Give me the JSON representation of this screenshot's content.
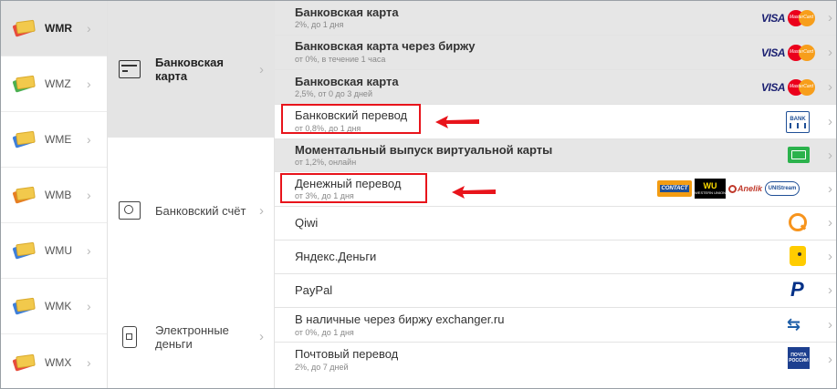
{
  "wallets": [
    {
      "label": "WMR",
      "color": "#e74c3c",
      "active": true
    },
    {
      "label": "WMZ",
      "color": "#4caf50",
      "active": false
    },
    {
      "label": "WME",
      "color": "#3f7fd8",
      "active": false
    },
    {
      "label": "WMB",
      "color": "#e67e22",
      "active": false
    },
    {
      "label": "WMU",
      "color": "#3f7fd8",
      "active": false
    },
    {
      "label": "WMK",
      "color": "#3f7fd8",
      "active": false
    },
    {
      "label": "WMX",
      "color": "#e74c3c",
      "active": false
    }
  ],
  "types": [
    {
      "label": "Банковская карта",
      "icon": "bank-card-icon",
      "active": true
    },
    {
      "label": "Банковский счёт",
      "icon": "safe-icon",
      "active": false
    },
    {
      "label": "Электронные деньги",
      "icon": "phone-wallet-icon",
      "active": false
    }
  ],
  "options": [
    {
      "title": "Банковская карта",
      "sub": "2%, до 1 дня",
      "logo": "visa-mastercard-logo"
    },
    {
      "title": "Банковская карта через биржу",
      "sub": "от 0%, в течение 1 часа",
      "logo": "visa-mastercard-logo"
    },
    {
      "title": "Банковская карта",
      "sub": "2,5%, от 0 до 3 дней",
      "logo": "visa-mastercard-logo"
    },
    {
      "title": "Банковский перевод",
      "sub": "от 0,8%, до 1 дня",
      "logo": "bank-icon"
    },
    {
      "title": "Моментальный выпуск виртуальной карты",
      "sub": "от 1,2%, онлайн",
      "logo": "virtual-card-icon"
    },
    {
      "title": "Денежный перевод",
      "sub": "от 3%, до 1 дня",
      "logo": "money-transfer-logos"
    },
    {
      "title": "Qiwi",
      "sub": "",
      "logo": "qiwi-icon"
    },
    {
      "title": "Яндекс.Деньги",
      "sub": "",
      "logo": "yandex-money-icon"
    },
    {
      "title": "PayPal",
      "sub": "",
      "logo": "paypal-icon"
    },
    {
      "title": "В наличные через биржу exchanger.ru",
      "sub": "от 0%, до 1 дня",
      "logo": "exchange-arrows-icon"
    },
    {
      "title": "Почтовый перевод",
      "sub": "2%, до 7 дней",
      "logo": "russian-post-icon"
    }
  ],
  "logos": {
    "visa": "VISA",
    "mastercard": "MasterCard",
    "bank": "BANK",
    "contact": "CONTACT",
    "wu": "WU",
    "western_union": "WESTERN UNION",
    "anelik": "Anelik",
    "unistream": "UNIStream",
    "post": "ПОЧТА РОССИИ"
  },
  "colors": {
    "highlight_red": "#e8141b",
    "active_bg": "#e4e4e4",
    "qiwi": "#f7941d",
    "yandex": "#ffcc00",
    "paypal": "#003087",
    "post": "#1d3f8f",
    "exchange": "#1f5fa8"
  },
  "chevron": "›"
}
